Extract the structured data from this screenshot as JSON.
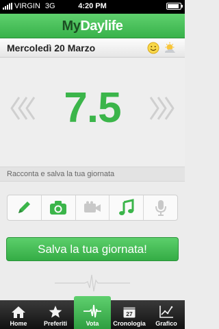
{
  "status": {
    "carrier": "VIRGIN",
    "network": "3G",
    "time": "4:20 PM",
    "battery_level": 0.9
  },
  "app": {
    "title_part1": "My",
    "title_part2": "Daylife"
  },
  "date": {
    "label": "Mercoledì 20 Marzo",
    "icons": [
      "smiley-icon",
      "weather-icon"
    ]
  },
  "score": {
    "value": "7.5",
    "color": "#3bb54a"
  },
  "caption": "Racconta e salva la tua giornata",
  "media": [
    {
      "name": "pencil-icon"
    },
    {
      "name": "camera-icon"
    },
    {
      "name": "video-icon"
    },
    {
      "name": "music-icon"
    },
    {
      "name": "microphone-icon"
    }
  ],
  "save_label": "Salva la tua giornata!",
  "tabs": [
    {
      "label": "Home",
      "icon": "home-icon",
      "active": false
    },
    {
      "label": "Preferiti",
      "icon": "star-icon",
      "active": false
    },
    {
      "label": "Vota",
      "icon": "pulse-icon",
      "active": true
    },
    {
      "label": "Cronologia",
      "icon": "calendar-icon",
      "active": false,
      "icon_text": "27"
    },
    {
      "label": "Grafico",
      "icon": "chart-icon",
      "active": false
    }
  ],
  "colors": {
    "accent": "#3bb54a",
    "header_dark": "#1b4d22"
  }
}
